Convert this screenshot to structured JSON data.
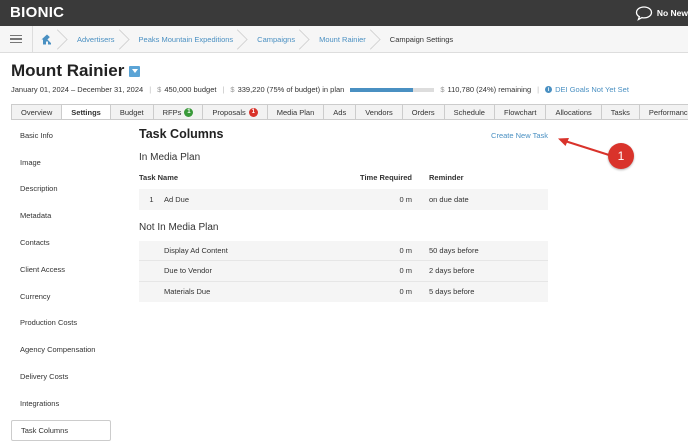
{
  "topbar": {
    "logo": "BIONIC",
    "news_label": "No New"
  },
  "breadcrumb": [
    "Advertisers",
    "Peaks Mountain Expeditions",
    "Campaigns",
    "Mount Rainier",
    "Campaign Settings"
  ],
  "header": {
    "title": "Mount Rainier",
    "date_range": "January 01, 2024 – December 31, 2024",
    "budget_text": "450,000 budget",
    "in_plan_text": "339,220 (75% of budget) in plan",
    "in_plan_fraction": 0.75,
    "remaining_text": "110,780 (24%) remaining",
    "dei_text": "DEI Goals Not Yet Set",
    "currency_symbol": "$"
  },
  "tabs": [
    {
      "label": "Overview"
    },
    {
      "label": "Settings",
      "active": true
    },
    {
      "label": "Budget"
    },
    {
      "label": "RFPs",
      "badge": "1",
      "badge_color": "green"
    },
    {
      "label": "Proposals",
      "badge": "1",
      "badge_color": "red"
    },
    {
      "label": "Media Plan"
    },
    {
      "label": "Ads"
    },
    {
      "label": "Vendors"
    },
    {
      "label": "Orders"
    },
    {
      "label": "Schedule"
    },
    {
      "label": "Flowchart"
    },
    {
      "label": "Allocations"
    },
    {
      "label": "Tasks"
    },
    {
      "label": "Performance"
    }
  ],
  "sidebar": {
    "items": [
      "Basic Info",
      "Image",
      "Description",
      "Metadata",
      "Contacts",
      "Client Access",
      "Currency",
      "Production Costs",
      "Agency Compensation",
      "Delivery Costs",
      "Integrations",
      "Task Columns"
    ],
    "active": "Task Columns"
  },
  "main": {
    "title": "Task Columns",
    "create_link": "Create New Task",
    "in_plan_title": "In Media Plan",
    "not_in_plan_title": "Not In Media Plan",
    "columns": {
      "name": "Task Name",
      "time": "Time Required",
      "reminder": "Reminder"
    },
    "in_plan_tasks": [
      {
        "num": "1",
        "name": "Ad Due",
        "time": "0 m",
        "reminder": "on due date"
      }
    ],
    "not_in_plan_tasks": [
      {
        "num": "",
        "name": "Display Ad Content",
        "time": "0 m",
        "reminder": "50 days before"
      },
      {
        "num": "",
        "name": "Due to Vendor",
        "time": "0 m",
        "reminder": "2 days before"
      },
      {
        "num": "",
        "name": "Materials Due",
        "time": "0 m",
        "reminder": "5 days before"
      }
    ]
  },
  "annotation": {
    "callout_number": "1"
  },
  "colors": {
    "topbar": "#3a3a3a",
    "link": "#4a90c2",
    "annotation_red": "#d9332b",
    "badge_green": "#3a9a3a"
  }
}
